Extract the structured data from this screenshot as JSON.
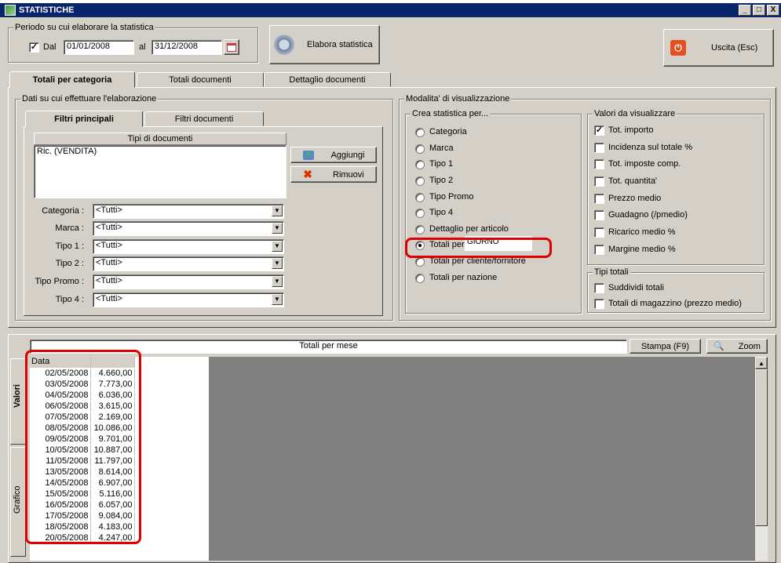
{
  "window": {
    "title": "STATISTICHE",
    "controls": [
      "_",
      "□",
      "X"
    ]
  },
  "periodo": {
    "label": "Periodo su cui elaborare la statistica",
    "dal_checked": true,
    "dal_label": "Dal",
    "dal_value": "01/01/2008",
    "al_label": "al",
    "al_value": "31/12/2008"
  },
  "buttons": {
    "elabora": "Elabora statistica",
    "uscita": "Uscita (Esc)",
    "aggiungi": "Aggiungi",
    "rimuovi": "Rimuovi",
    "stampa": "Stampa (F9)",
    "zoom": "Zoom"
  },
  "main_tabs": [
    "Totali per categoria",
    "Totali documenti",
    "Dettaglio documenti"
  ],
  "dati": {
    "label": "Dati su cui effettuare l'elaborazione",
    "tabs": [
      "Filtri principali",
      "Filtri documenti"
    ],
    "tipi_header": "Tipi di documenti",
    "tipi_items": [
      "Ric. (VENDITA)"
    ],
    "filters": [
      {
        "label": "Categoria :",
        "value": "<Tutti>"
      },
      {
        "label": "Marca :",
        "value": "<Tutti>"
      },
      {
        "label": "Tipo 1 :",
        "value": "<Tutti>"
      },
      {
        "label": "Tipo 2 :",
        "value": "<Tutti>"
      },
      {
        "label": "Tipo Promo :",
        "value": "<Tutti>"
      },
      {
        "label": "Tipo 4 :",
        "value": "<Tutti>"
      }
    ]
  },
  "modalita": {
    "label": "Modalita' di visualizzazione",
    "crea_label": "Crea statistica per...",
    "radios": [
      "Categoria",
      "Marca",
      "Tipo 1",
      "Tipo 2",
      "Tipo Promo",
      "Tipo 4",
      "Dettaglio per articolo",
      "Totali per",
      "Totali per cliente/fornitore",
      "Totali per nazione"
    ],
    "selected": 7,
    "totali_per_value": "GIORNO",
    "valori_label": "Valori da visualizzare",
    "valori": [
      {
        "label": "Tot. importo",
        "checked": true
      },
      {
        "label": "Incidenza sul totale %",
        "checked": false
      },
      {
        "label": "Tot. imposte comp.",
        "checked": false
      },
      {
        "label": "Tot. quantita'",
        "checked": false
      },
      {
        "label": "Prezzo medio",
        "checked": false
      },
      {
        "label": "Guadagno (/pmedio)",
        "checked": false
      },
      {
        "label": "Ricarico medio %",
        "checked": false
      },
      {
        "label": "Margine medio %",
        "checked": false
      }
    ],
    "tipi_totali_label": "Tipi totali",
    "tipi_totali": [
      {
        "label": "Suddividi totali",
        "checked": false
      },
      {
        "label": "Totali di magazzino (prezzo medio)",
        "checked": false
      }
    ]
  },
  "results": {
    "title": "Totali per mese",
    "side_tabs": [
      "Valori",
      "Grafico"
    ],
    "col_header": "Data",
    "rows": [
      [
        "02/05/2008",
        "4.660,00"
      ],
      [
        "03/05/2008",
        "7.773,00"
      ],
      [
        "04/05/2008",
        "6.036,00"
      ],
      [
        "06/05/2008",
        "3.615,00"
      ],
      [
        "07/05/2008",
        "2.169,00"
      ],
      [
        "08/05/2008",
        "10.086,00"
      ],
      [
        "09/05/2008",
        "9.701,00"
      ],
      [
        "10/05/2008",
        "10.887,00"
      ],
      [
        "11/05/2008",
        "11.797,00"
      ],
      [
        "13/05/2008",
        "8.614,00"
      ],
      [
        "14/05/2008",
        "6.907,00"
      ],
      [
        "15/05/2008",
        "5.116,00"
      ],
      [
        "16/05/2008",
        "6.057,00"
      ],
      [
        "17/05/2008",
        "9.084,00"
      ],
      [
        "18/05/2008",
        "4.183,00"
      ],
      [
        "20/05/2008",
        "4.247,00"
      ]
    ]
  }
}
